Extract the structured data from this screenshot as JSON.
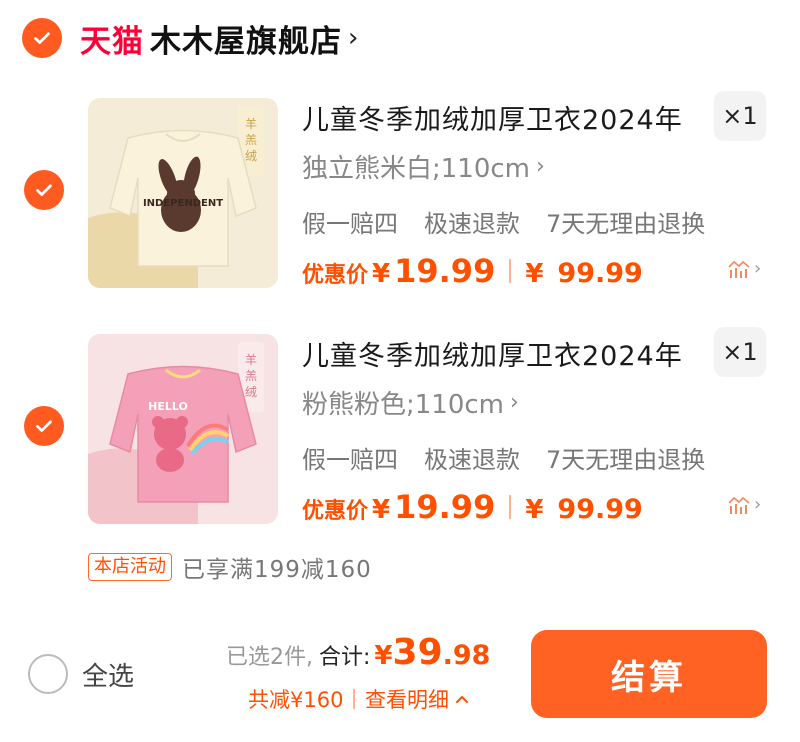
{
  "store": {
    "platform": "天猫",
    "name": "木木屋旗舰店",
    "chevron": "›"
  },
  "items": [
    {
      "title": "儿童冬季加绒加厚卫衣2024年",
      "quantity": "×1",
      "sku": "独立熊米白;110cm",
      "services": [
        "假一赔四",
        "极速退款",
        "7天无理由退换"
      ],
      "price_label": "优惠价",
      "currency": "¥",
      "price": "19.99",
      "original_price": "99.99",
      "thumb_text": "INDEPENDENT",
      "thumb_bg": "#f4ecd6",
      "garment_color": "#fbf2dc"
    },
    {
      "title": "儿童冬季加绒加厚卫衣2024年",
      "quantity": "×1",
      "sku": "粉熊粉色;110cm",
      "services": [
        "假一赔四",
        "极速退款",
        "7天无理由退换"
      ],
      "price_label": "优惠价",
      "currency": "¥",
      "price": "19.99",
      "original_price": "99.99",
      "thumb_text": "HELLO",
      "thumb_bg": "#f8e3e4",
      "garment_color": "#f4a0b8"
    }
  ],
  "promo": {
    "badge": "本店活动",
    "text": "已享满199减160"
  },
  "footer": {
    "select_all": "全选",
    "selected_count": "已选2件,",
    "total_label": "合计:",
    "currency": "¥",
    "total_int": "39",
    "total_dec": ".98",
    "discount": "共减¥160",
    "detail_link": "查看明细",
    "checkout": "结算"
  },
  "colors": {
    "accent": "#ff5000",
    "tmall_red": "#ff0036",
    "checkout_bg": "#ff6222"
  }
}
